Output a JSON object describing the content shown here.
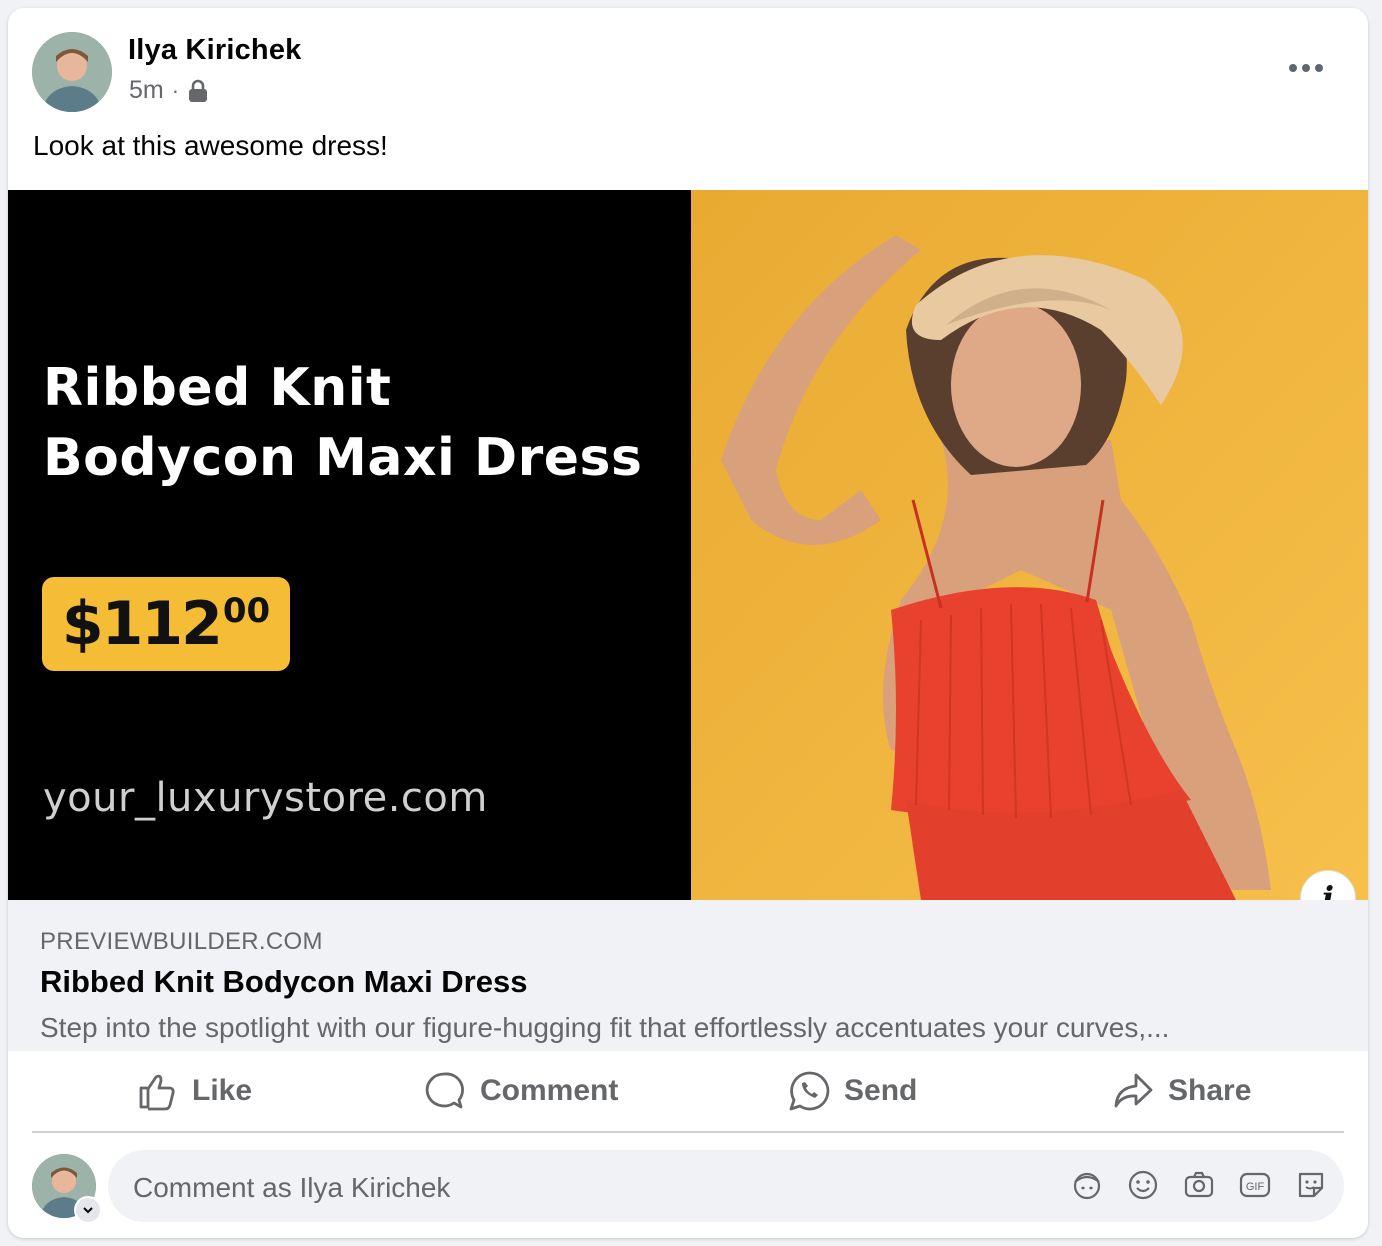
{
  "post": {
    "author": "Ilya Kirichek",
    "timestamp": "5m",
    "separator": "·",
    "privacy_icon": "lock-icon",
    "text": "Look at this awesome dress!"
  },
  "ad_image": {
    "title": "Ribbed Knit Bodycon Maxi Dress",
    "price_main": "$112",
    "price_cents": "00",
    "domain": "your_luxurystore.com",
    "background_left": "#000000",
    "background_right": "#f2b63a",
    "badge_color": "#f5bd35"
  },
  "link_preview": {
    "domain": "PREVIEWBUILDER.COM",
    "title": "Ribbed Knit Bodycon Maxi Dress",
    "description": "Step into the spotlight with our figure-hugging fit that effortlessly accentuates your curves,..."
  },
  "actions": {
    "like": "Like",
    "comment": "Comment",
    "send": "Send",
    "share": "Share"
  },
  "comment_box": {
    "placeholder": "Comment as Ilya Kirichek",
    "tools": [
      "avatar-sticker-icon",
      "emoji-icon",
      "camera-icon",
      "gif-icon",
      "sticker-icon"
    ]
  },
  "colors": {
    "text_primary": "#050505",
    "text_secondary": "#65676b",
    "surface": "#f0f2f5"
  }
}
